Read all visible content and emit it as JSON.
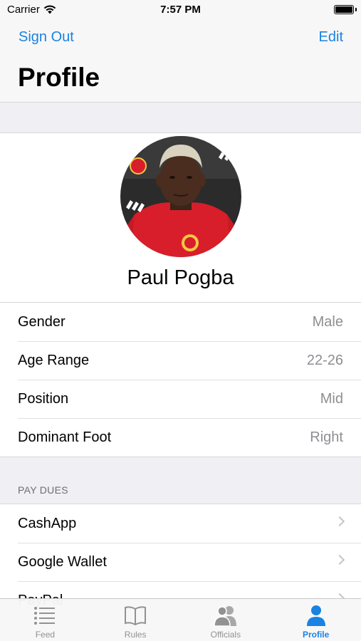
{
  "status": {
    "carrier": "Carrier",
    "time": "7:57 PM"
  },
  "nav": {
    "left_button": "Sign Out",
    "right_button": "Edit",
    "title": "Profile"
  },
  "profile": {
    "name": "Paul Pogba"
  },
  "info": [
    {
      "label": "Gender",
      "value": "Male"
    },
    {
      "label": "Age Range",
      "value": "22-26"
    },
    {
      "label": "Position",
      "value": "Mid"
    },
    {
      "label": "Dominant Foot",
      "value": "Right"
    }
  ],
  "pay_dues": {
    "header": "PAY DUES",
    "items": [
      "CashApp",
      "Google Wallet",
      "PayPal"
    ]
  },
  "tabs": [
    {
      "label": "Feed",
      "icon": "list-icon"
    },
    {
      "label": "Rules",
      "icon": "book-icon"
    },
    {
      "label": "Officials",
      "icon": "people-icon"
    },
    {
      "label": "Profile",
      "icon": "person-icon",
      "active": true
    }
  ],
  "colors": {
    "accent": "#1a82e2",
    "inactive": "#929292"
  }
}
